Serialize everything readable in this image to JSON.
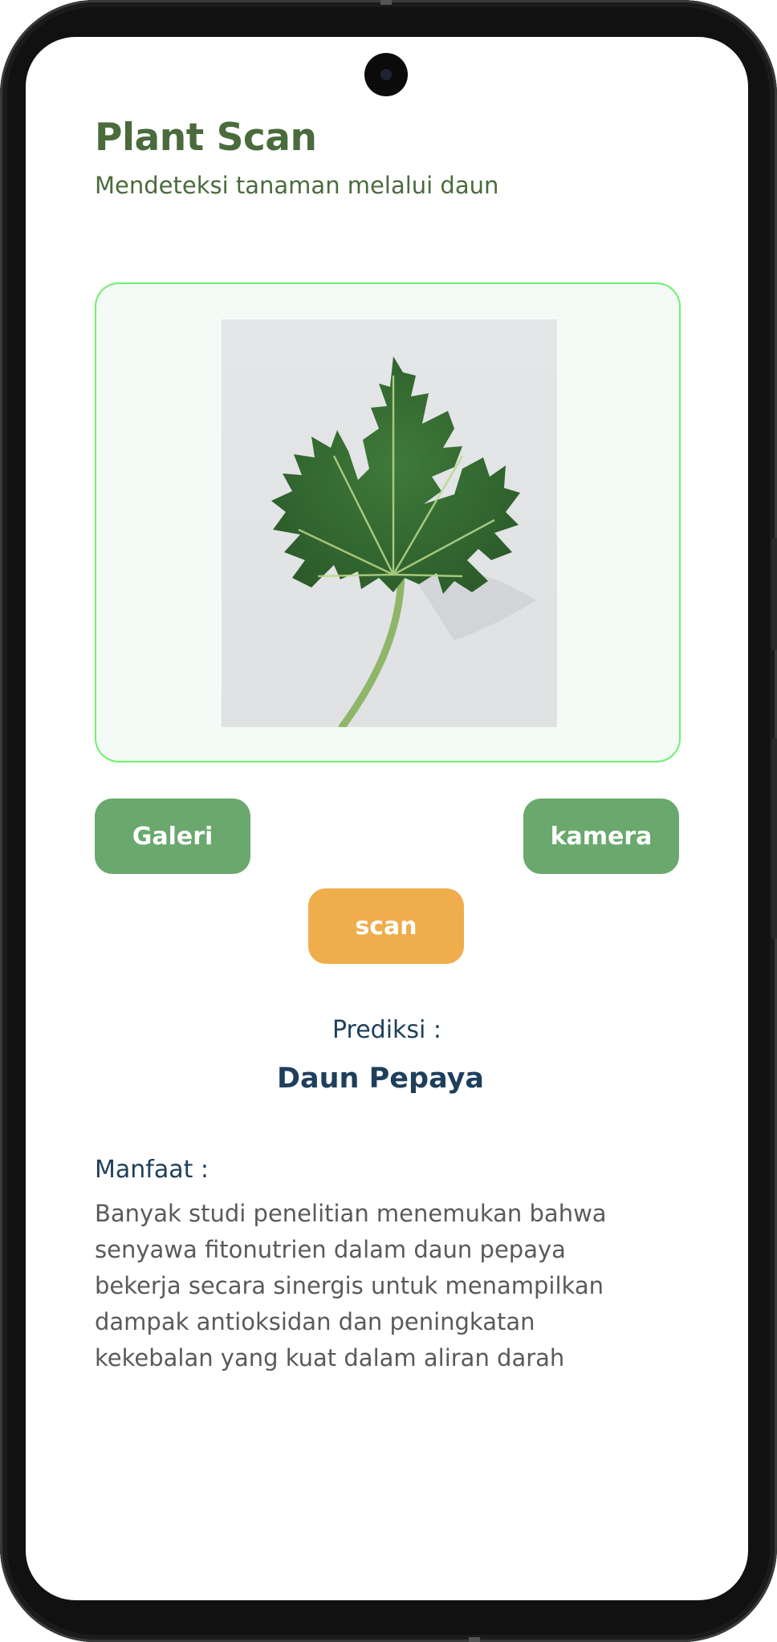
{
  "app": {
    "title": "Plant Scan",
    "subtitle": "Mendeteksi tanaman melalui daun"
  },
  "image_preview": {
    "content": "papaya-leaf-photo"
  },
  "actions": {
    "gallery_label": "Galeri",
    "camera_label": "kamera",
    "scan_label": "scan"
  },
  "prediction": {
    "label": "Prediksi :",
    "value": "Daun Pepaya"
  },
  "benefit": {
    "label": "Manfaat :",
    "text": "Banyak studi penelitian menemukan bahwa senyawa fitonutrien dalam daun pepaya bekerja secara sinergis untuk menampilkan dampak antioksidan dan peningkatan kekebalan yang kuat dalam aliran darah"
  },
  "colors": {
    "title": "#4a6b3c",
    "card_border": "#6ef06e",
    "button_green": "#6aa86e",
    "button_orange": "#efad4b",
    "prediction_text": "#1e3f5c",
    "body_text": "#5a5a5a"
  }
}
